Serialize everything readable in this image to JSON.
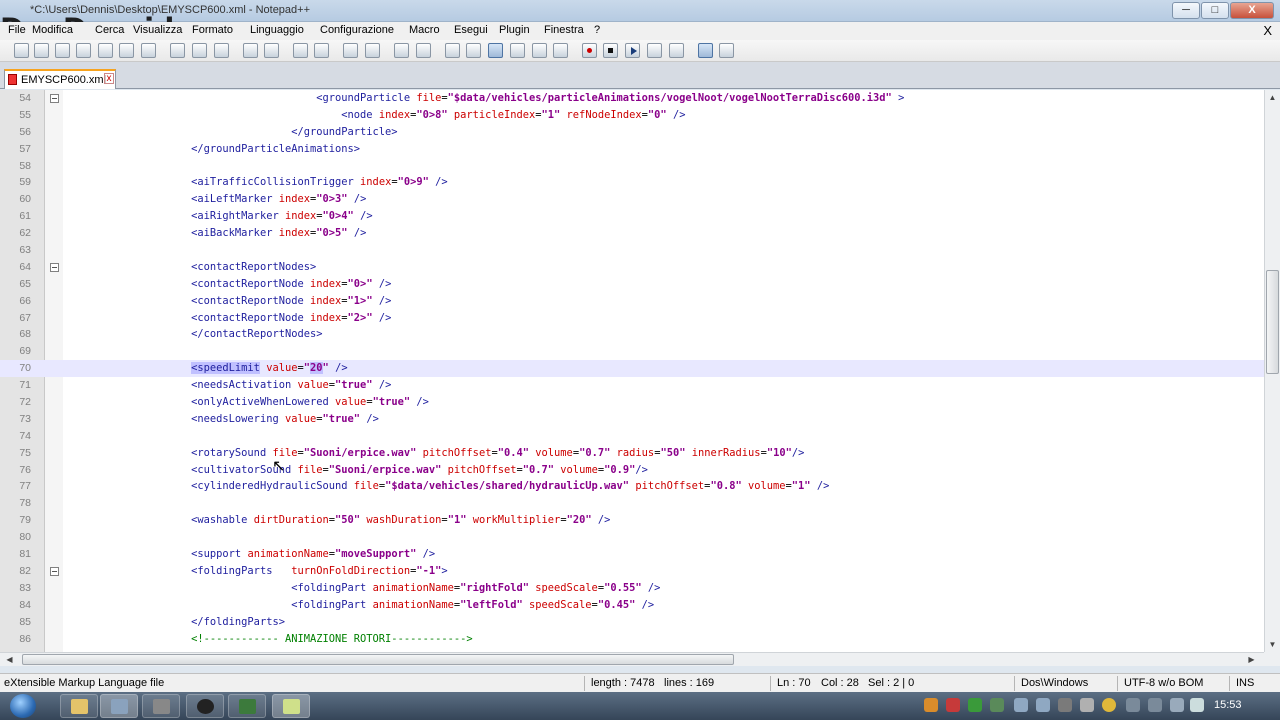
{
  "window": {
    "title": "*C:\\Users\\Dennis\\Desktop\\EMYSCP600.xml - Notepad++",
    "watermark": "DenDenvideo",
    "min_label": "─",
    "max_label": "□",
    "close_label": "X"
  },
  "menu": {
    "items": [
      "File",
      "Modifica",
      "Cerca",
      "Visualizza",
      "Formato",
      "Linguaggio",
      "Configurazione",
      "Macro",
      "Esegui",
      "Plugin",
      "Finestra",
      "?"
    ],
    "close_label": "X"
  },
  "tab": {
    "label": "EMYSCP600.xml",
    "close_label": "x"
  },
  "editor": {
    "current_line": 70,
    "lines": [
      {
        "n": "54",
        "fold": true,
        "ind": "          ",
        "html": "<span class='t'>&lt;groundParticle</span> <span class='a'>file</span>=<span class='v'>\"$data/vehicles/particleAnimations/vogelNoot/vogelNootTerraDisc600.i3d\"</span> <span class='t'>&gt;</span>"
      },
      {
        "n": "55",
        "fold": false,
        "ind": "           ",
        "html": "<span class='t'>&lt;node</span> <span class='a'>index</span>=<span class='v'>\"0&gt;8\"</span> <span class='a'>particleIndex</span>=<span class='v'>\"1\"</span> <span class='a'>refNodeIndex</span>=<span class='v'>\"0\"</span> <span class='t'>/&gt;</span>"
      },
      {
        "n": "56",
        "fold": false,
        "ind": "         ",
        "html": "<span class='t'>&lt;/groundParticle&gt;</span>"
      },
      {
        "n": "57",
        "fold": false,
        "ind": "     ",
        "html": "<span class='t'>&lt;/groundParticleAnimations&gt;</span>"
      },
      {
        "n": "58",
        "fold": false,
        "ind": "",
        "html": ""
      },
      {
        "n": "59",
        "fold": false,
        "ind": "     ",
        "html": "<span class='t'>&lt;aiTrafficCollisionTrigger</span> <span class='a'>index</span>=<span class='v'>\"0&gt;9\"</span> <span class='t'>/&gt;</span>"
      },
      {
        "n": "60",
        "fold": false,
        "ind": "     ",
        "html": "<span class='t'>&lt;aiLeftMarker</span> <span class='a'>index</span>=<span class='v'>\"0&gt;3\"</span> <span class='t'>/&gt;</span>"
      },
      {
        "n": "61",
        "fold": false,
        "ind": "     ",
        "html": "<span class='t'>&lt;aiRightMarker</span> <span class='a'>index</span>=<span class='v'>\"0&gt;4\"</span> <span class='t'>/&gt;</span>"
      },
      {
        "n": "62",
        "fold": false,
        "ind": "     ",
        "html": "<span class='t'>&lt;aiBackMarker</span> <span class='a'>index</span>=<span class='v'>\"0&gt;5\"</span> <span class='t'>/&gt;</span>"
      },
      {
        "n": "63",
        "fold": false,
        "ind": "",
        "html": ""
      },
      {
        "n": "64",
        "fold": true,
        "ind": "     ",
        "html": "<span class='t'>&lt;contactReportNodes&gt;</span>"
      },
      {
        "n": "65",
        "fold": false,
        "ind": "     ",
        "html": "<span class='t'>&lt;contactReportNode</span> <span class='a'>index</span>=<span class='v'>\"0&gt;\"</span> <span class='t'>/&gt;</span>"
      },
      {
        "n": "66",
        "fold": false,
        "ind": "     ",
        "html": "<span class='t'>&lt;contactReportNode</span> <span class='a'>index</span>=<span class='v'>\"1&gt;\"</span> <span class='t'>/&gt;</span>"
      },
      {
        "n": "67",
        "fold": false,
        "ind": "     ",
        "html": "<span class='t'>&lt;contactReportNode</span> <span class='a'>index</span>=<span class='v'>\"2&gt;\"</span> <span class='t'>/&gt;</span>"
      },
      {
        "n": "68",
        "fold": false,
        "ind": "     ",
        "html": "<span class='t'>&lt;/contactReportNodes&gt;</span>"
      },
      {
        "n": "69",
        "fold": false,
        "ind": "",
        "html": ""
      },
      {
        "n": "70",
        "fold": false,
        "ind": "     ",
        "html": "<span class='t hl'>&lt;speedLimit</span> <span class='a'>value</span>=<span class='v'>\"<span class='hl'>20</span>\"</span> <span class='t'>/&gt;</span>"
      },
      {
        "n": "71",
        "fold": false,
        "ind": "     ",
        "html": "<span class='t'>&lt;needsActivation</span> <span class='a'>value</span>=<span class='v'>\"true\"</span> <span class='t'>/&gt;</span>"
      },
      {
        "n": "72",
        "fold": false,
        "ind": "     ",
        "html": "<span class='t'>&lt;onlyActiveWhenLowered</span> <span class='a'>value</span>=<span class='v'>\"true\"</span> <span class='t'>/&gt;</span>"
      },
      {
        "n": "73",
        "fold": false,
        "ind": "     ",
        "html": "<span class='t'>&lt;needsLowering</span> <span class='a'>value</span>=<span class='v'>\"true\"</span> <span class='t'>/&gt;</span>"
      },
      {
        "n": "74",
        "fold": false,
        "ind": "",
        "html": ""
      },
      {
        "n": "75",
        "fold": false,
        "ind": "     ",
        "html": "<span class='t'>&lt;rotarySound</span> <span class='a'>file</span>=<span class='v'>\"Suoni/erpice.wav\"</span> <span class='a'>pitchOffset</span>=<span class='v'>\"0.4\"</span> <span class='a'>volume</span>=<span class='v'>\"0.7\"</span> <span class='a'>radius</span>=<span class='v'>\"50\"</span> <span class='a'>innerRadius</span>=<span class='v'>\"10\"</span><span class='t'>/&gt;</span>"
      },
      {
        "n": "76",
        "fold": false,
        "ind": "     ",
        "html": "<span class='t'>&lt;cultivatorSound</span> <span class='a'>file</span>=<span class='v'>\"Suoni/erpice.wav\"</span> <span class='a'>pitchOffset</span>=<span class='v'>\"0.7\"</span> <span class='a'>volume</span>=<span class='v'>\"0.9\"</span><span class='t'>/&gt;</span>"
      },
      {
        "n": "77",
        "fold": false,
        "ind": "     ",
        "html": "<span class='t'>&lt;cylinderedHydraulicSound</span> <span class='a'>file</span>=<span class='v'>\"$data/vehicles/shared/hydraulicUp.wav\"</span> <span class='a'>pitchOffset</span>=<span class='v'>\"0.8\"</span> <span class='a'>volume</span>=<span class='v'>\"1\"</span> <span class='t'>/&gt;</span>"
      },
      {
        "n": "78",
        "fold": false,
        "ind": "",
        "html": ""
      },
      {
        "n": "79",
        "fold": false,
        "ind": "     ",
        "html": "<span class='t'>&lt;washable</span> <span class='a'>dirtDuration</span>=<span class='v'>\"50\"</span> <span class='a'>washDuration</span>=<span class='v'>\"1\"</span> <span class='a'>workMultiplier</span>=<span class='v'>\"20\"</span> <span class='t'>/&gt;</span>"
      },
      {
        "n": "80",
        "fold": false,
        "ind": "",
        "html": ""
      },
      {
        "n": "81",
        "fold": false,
        "ind": "     ",
        "html": "<span class='t'>&lt;support</span> <span class='a'>animationName</span>=<span class='v'>\"moveSupport\"</span> <span class='t'>/&gt;</span>"
      },
      {
        "n": "82",
        "fold": true,
        "ind": "     ",
        "html": "<span class='t'>&lt;foldingParts</span>   <span class='a'>turnOnFoldDirection</span>=<span class='v'>\"-1\"</span><span class='t'>&gt;</span>"
      },
      {
        "n": "83",
        "fold": false,
        "ind": "         ",
        "html": "<span class='t'>&lt;foldingPart</span> <span class='a'>animationName</span>=<span class='v'>\"rightFold\"</span> <span class='a'>speedScale</span>=<span class='v'>\"0.55\"</span> <span class='t'>/&gt;</span>"
      },
      {
        "n": "84",
        "fold": false,
        "ind": "         ",
        "html": "<span class='t'>&lt;foldingPart</span> <span class='a'>animationName</span>=<span class='v'>\"leftFold\"</span> <span class='a'>speedScale</span>=<span class='v'>\"0.45\"</span> <span class='t'>/&gt;</span>"
      },
      {
        "n": "85",
        "fold": false,
        "ind": "     ",
        "html": "<span class='t'>&lt;/foldingParts&gt;</span>"
      },
      {
        "n": "86",
        "fold": false,
        "ind": "     ",
        "html": "<span class='c'>&lt;!------------ ANIMAZIONE ROTORI------------&gt;</span>"
      }
    ]
  },
  "status": {
    "file_type": "eXtensible Markup Language file",
    "length": "length : 7478",
    "lines": "lines : 169",
    "ln": "Ln : 70",
    "col": "Col : 28",
    "sel": "Sel : 2 | 0",
    "eol": "Dos\\Windows",
    "encoding": "UTF-8 w/o BOM",
    "mode": "INS"
  },
  "taskbar": {
    "clock": "15:53"
  },
  "colors": {
    "tag": "#1e1e9e",
    "attribute": "#cc0000",
    "value": "#8a008a",
    "comment": "#008000",
    "current_line": "#e8e8ff"
  }
}
